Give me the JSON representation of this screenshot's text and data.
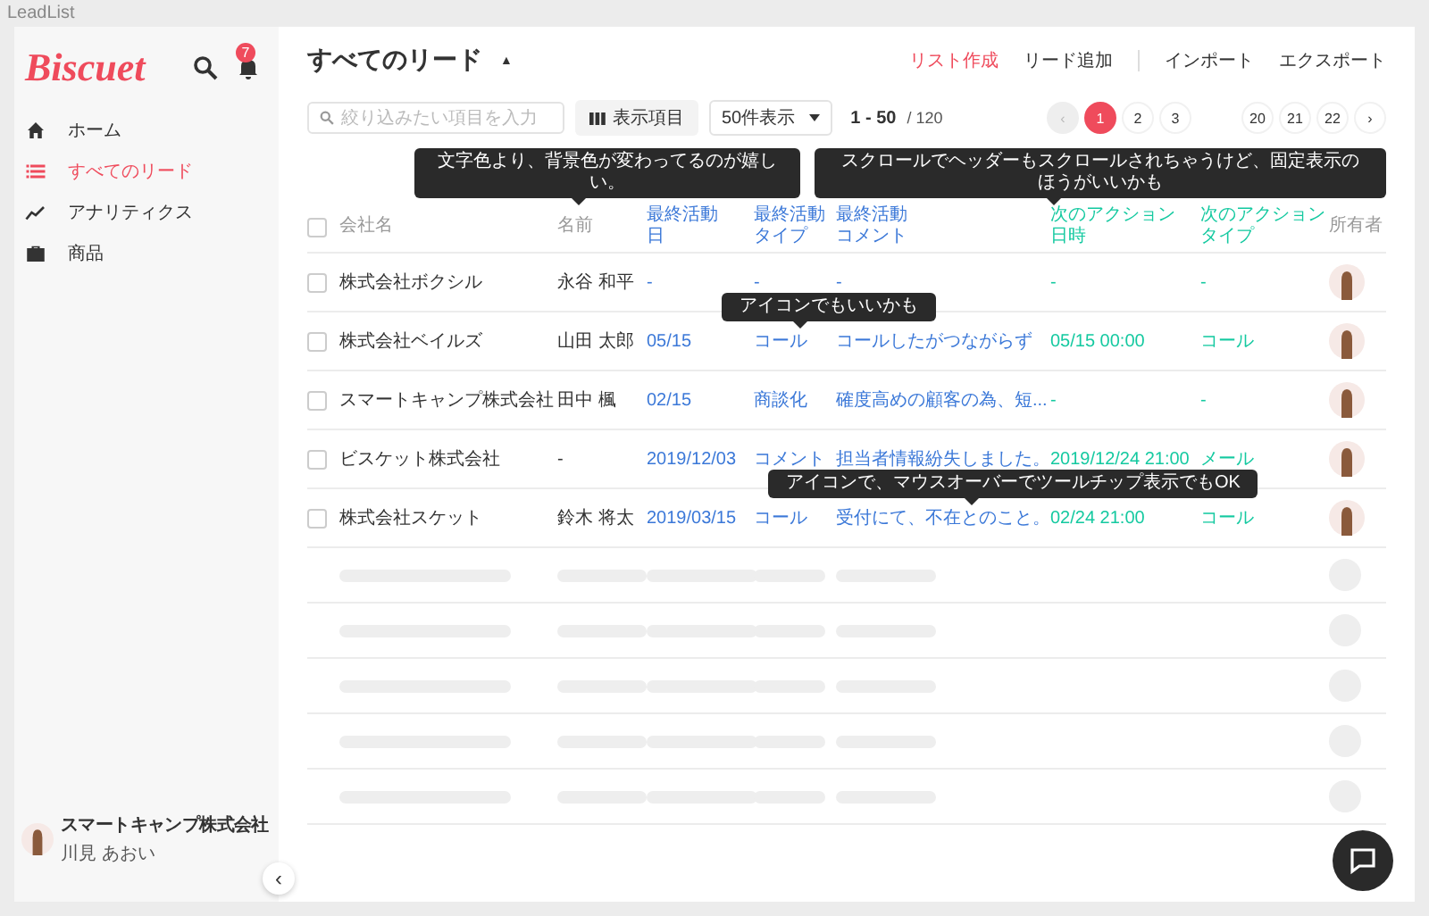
{
  "window": {
    "title": "LeadList"
  },
  "sidebar": {
    "logo": "Biscuet",
    "notification_count": "7",
    "nav": [
      {
        "label": "ホーム",
        "selected": false
      },
      {
        "label": "すべてのリード",
        "selected": true
      },
      {
        "label": "アナリティクス",
        "selected": false
      },
      {
        "label": "商品",
        "selected": false
      }
    ],
    "account": {
      "company": "スマートキャンプ株式会社",
      "user": "川見 あおい"
    },
    "collapse": "‹"
  },
  "header": {
    "title": "すべてのリード",
    "caret": "▲",
    "actions": [
      {
        "label": "リスト作成",
        "kind": "primary"
      },
      {
        "label": "リード追加",
        "kind": "plain"
      },
      {
        "label": "インポート",
        "kind": "plain"
      },
      {
        "label": "エクスポート",
        "kind": "plain"
      }
    ]
  },
  "toolbar": {
    "search": {
      "placeholder": "絞り込みたい項目を入力"
    },
    "columns_button": "表示項目",
    "page_size": "50件表示",
    "range": "1 - 50",
    "total": "/ 120"
  },
  "pagination": {
    "prev": {
      "label": "‹",
      "disabled": true
    },
    "next": {
      "label": "›",
      "disabled": false
    },
    "pages": [
      {
        "label": "1",
        "selected": true
      },
      {
        "label": "2",
        "selected": false
      },
      {
        "label": "3",
        "selected": false
      },
      {
        "label": "20",
        "selected": false
      },
      {
        "label": "21",
        "selected": false
      },
      {
        "label": "22",
        "selected": false
      }
    ]
  },
  "table": {
    "select_all_checked": false,
    "columns": [
      {
        "label_lines": [
          "会社名"
        ],
        "kind": "plain"
      },
      {
        "label_lines": [
          "名前"
        ],
        "kind": "plain"
      },
      {
        "label_lines": [
          "最終活動",
          "日"
        ],
        "kind": "last"
      },
      {
        "label_lines": [
          "最終活動",
          "タイプ"
        ],
        "kind": "last"
      },
      {
        "label_lines": [
          "最終活動",
          "コメント"
        ],
        "kind": "last"
      },
      {
        "label_lines": [
          "次のアクション",
          "日時"
        ],
        "kind": "next"
      },
      {
        "label_lines": [
          "次のアクション",
          "タイプ"
        ],
        "kind": "next"
      },
      {
        "label_lines": [
          "所有者"
        ],
        "kind": "plain"
      }
    ],
    "rows": [
      {
        "checked": false,
        "cells": [
          "株式会社ボクシル",
          "永谷 和平",
          "-",
          "-",
          "-",
          "-",
          "-"
        ]
      },
      {
        "checked": false,
        "cells": [
          "株式会社ベイルズ",
          "山田 太郎",
          "05/15",
          "コール",
          "コールしたがつながらず",
          "05/15 00:00",
          "コール"
        ]
      },
      {
        "checked": false,
        "cells": [
          "スマートキャンプ株式会社",
          "田中 楓",
          "02/15",
          "商談化",
          "確度高めの顧客の為、短...",
          "-",
          "-"
        ]
      },
      {
        "checked": false,
        "cells": [
          "ビスケット株式会社",
          "-",
          "2019/12/03",
          "コメント",
          "担当者情報紛失しました。",
          "2019/12/24 21:00",
          "メール"
        ]
      },
      {
        "checked": false,
        "cells": [
          "株式会社スケット",
          "鈴木 将太",
          "2019/03/15",
          "コール",
          "受付にて、不在とのこと。",
          "02/24 21:00",
          "コール"
        ]
      }
    ]
  },
  "tooltips": [
    "文字色より、背景色が変わってるのが嬉しい。",
    "スクロールでヘッダーもスクロールされちゃうけど、固定表示のほうがいいかも",
    "アイコンでもいいかも",
    "アイコンで、マウスオーバーでツールチップ表示でもOK"
  ]
}
